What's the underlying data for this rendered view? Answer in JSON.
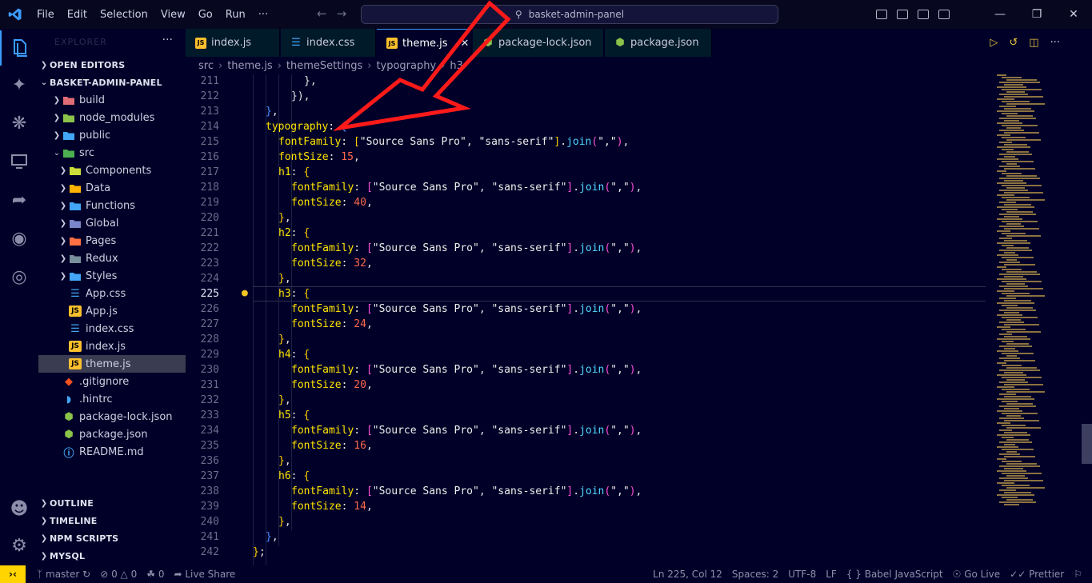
{
  "app": {
    "menu": [
      "File",
      "Edit",
      "Selection",
      "View",
      "Go",
      "Run",
      "···"
    ],
    "search": "basket-admin-panel"
  },
  "sidebar": {
    "title": "EXPLORER",
    "sections": {
      "open_editors": "OPEN EDITORS",
      "project": "BASKET-ADMIN-PANEL",
      "outline": "OUTLINE",
      "timeline": "TIMELINE",
      "npm": "NPM SCRIPTS",
      "mysql": "MYSQL"
    },
    "tree": [
      {
        "label": "build",
        "icon": "folder",
        "color": "#e06c75",
        "indent": 1
      },
      {
        "label": "node_modules",
        "icon": "folder",
        "color": "#8bc34a",
        "indent": 1
      },
      {
        "label": "public",
        "icon": "folder",
        "color": "#42a5f5",
        "indent": 1
      },
      {
        "label": "src",
        "icon": "folder-open",
        "color": "#4caf50",
        "indent": 1
      },
      {
        "label": "Components",
        "icon": "folder",
        "color": "#cddc39",
        "indent": 2
      },
      {
        "label": "Data",
        "icon": "folder",
        "color": "#ffb300",
        "indent": 2
      },
      {
        "label": "Functions",
        "icon": "folder",
        "color": "#42a5f5",
        "indent": 2
      },
      {
        "label": "Global",
        "icon": "folder",
        "color": "#7986cb",
        "indent": 2
      },
      {
        "label": "Pages",
        "icon": "folder",
        "color": "#ff7043",
        "indent": 2
      },
      {
        "label": "Redux",
        "icon": "folder",
        "color": "#78909c",
        "indent": 2
      },
      {
        "label": "Styles",
        "icon": "folder",
        "color": "#42a5f5",
        "indent": 2
      },
      {
        "label": "App.css",
        "icon": "css",
        "color": "#42a5f5",
        "indent": 2
      },
      {
        "label": "App.js",
        "icon": "js",
        "color": "#fbc02d",
        "indent": 2
      },
      {
        "label": "index.css",
        "icon": "css",
        "color": "#42a5f5",
        "indent": 2
      },
      {
        "label": "index.js",
        "icon": "js",
        "color": "#fbc02d",
        "indent": 2
      },
      {
        "label": "theme.js",
        "icon": "js",
        "color": "#fbc02d",
        "indent": 2,
        "selected": true
      },
      {
        "label": ".gitignore",
        "icon": "git",
        "color": "#f4511e",
        "indent": 1
      },
      {
        "label": ".hintrc",
        "icon": "hint",
        "color": "#42a5f5",
        "indent": 1
      },
      {
        "label": "package-lock.json",
        "icon": "node",
        "color": "#8bc34a",
        "indent": 1
      },
      {
        "label": "package.json",
        "icon": "node",
        "color": "#8bc34a",
        "indent": 1
      },
      {
        "label": "README.md",
        "icon": "info",
        "color": "#42a5f5",
        "indent": 1
      }
    ]
  },
  "tabs": [
    {
      "label": "index.js",
      "icon": "js",
      "color": "#fbc02d"
    },
    {
      "label": "index.css",
      "icon": "css",
      "color": "#42a5f5"
    },
    {
      "label": "theme.js",
      "icon": "js",
      "color": "#fbc02d",
      "active": true
    },
    {
      "label": "package-lock.json",
      "icon": "node",
      "color": "#8bc34a"
    },
    {
      "label": "package.json",
      "icon": "node",
      "color": "#8bc34a"
    }
  ],
  "breadcrumb": [
    "src",
    "theme.js",
    "themeSettings",
    "typography",
    "h3"
  ],
  "editor": {
    "current_line": 225,
    "lines": [
      {
        "n": 211,
        "indent": 6,
        "tokens": [
          [
            "p",
            "},"
          ]
        ]
      },
      {
        "n": 212,
        "indent": 5,
        "tokens": [
          [
            "p",
            "}),"
          ]
        ]
      },
      {
        "n": 213,
        "indent": 3,
        "tokens": [
          [
            "b2",
            "}"
          ],
          [
            "p",
            ","
          ]
        ]
      },
      {
        "n": 214,
        "indent": 3,
        "tokens": [
          [
            "k",
            "typography"
          ],
          [
            "p",
            ": "
          ],
          [
            "b2",
            "{"
          ]
        ]
      },
      {
        "n": 215,
        "indent": 4,
        "tokens": [
          [
            "k",
            "fontFamily"
          ],
          [
            "p",
            ": "
          ],
          [
            "b3",
            "["
          ],
          [
            "s",
            "\"Source Sans Pro\""
          ],
          [
            "p",
            ", "
          ],
          [
            "s",
            "\"sans-serif\""
          ],
          [
            "b3",
            "]"
          ],
          [
            "p",
            "."
          ],
          [
            "f",
            "join"
          ],
          [
            "b1",
            "("
          ],
          [
            "s",
            "\",\""
          ],
          [
            "b1",
            ")"
          ],
          [
            "p",
            ","
          ]
        ]
      },
      {
        "n": 216,
        "indent": 4,
        "tokens": [
          [
            "k",
            "fontSize"
          ],
          [
            "p",
            ": "
          ],
          [
            "n",
            "15"
          ],
          [
            "p",
            ","
          ]
        ]
      },
      {
        "n": 217,
        "indent": 4,
        "tokens": [
          [
            "k",
            "h1"
          ],
          [
            "p",
            ": "
          ],
          [
            "b3",
            "{"
          ]
        ]
      },
      {
        "n": 218,
        "indent": 5,
        "tokens": [
          [
            "k",
            "fontFamily"
          ],
          [
            "p",
            ": "
          ],
          [
            "b1",
            "["
          ],
          [
            "s",
            "\"Source Sans Pro\""
          ],
          [
            "p",
            ", "
          ],
          [
            "s",
            "\"sans-serif\""
          ],
          [
            "b1",
            "]"
          ],
          [
            "p",
            "."
          ],
          [
            "f",
            "join"
          ],
          [
            "b1",
            "("
          ],
          [
            "s",
            "\",\""
          ],
          [
            "b1",
            ")"
          ],
          [
            "p",
            ","
          ]
        ]
      },
      {
        "n": 219,
        "indent": 5,
        "tokens": [
          [
            "k",
            "fontSize"
          ],
          [
            "p",
            ": "
          ],
          [
            "n",
            "40"
          ],
          [
            "p",
            ","
          ]
        ]
      },
      {
        "n": 220,
        "indent": 4,
        "tokens": [
          [
            "b3",
            "}"
          ],
          [
            "p",
            ","
          ]
        ]
      },
      {
        "n": 221,
        "indent": 4,
        "tokens": [
          [
            "k",
            "h2"
          ],
          [
            "p",
            ": "
          ],
          [
            "b3",
            "{"
          ]
        ]
      },
      {
        "n": 222,
        "indent": 5,
        "tokens": [
          [
            "k",
            "fontFamily"
          ],
          [
            "p",
            ": "
          ],
          [
            "b1",
            "["
          ],
          [
            "s",
            "\"Source Sans Pro\""
          ],
          [
            "p",
            ", "
          ],
          [
            "s",
            "\"sans-serif\""
          ],
          [
            "b1",
            "]"
          ],
          [
            "p",
            "."
          ],
          [
            "f",
            "join"
          ],
          [
            "b1",
            "("
          ],
          [
            "s",
            "\",\""
          ],
          [
            "b1",
            ")"
          ],
          [
            "p",
            ","
          ]
        ]
      },
      {
        "n": 223,
        "indent": 5,
        "tokens": [
          [
            "k",
            "fontSize"
          ],
          [
            "p",
            ": "
          ],
          [
            "n",
            "32"
          ],
          [
            "p",
            ","
          ]
        ]
      },
      {
        "n": 224,
        "indent": 4,
        "tokens": [
          [
            "b3",
            "}"
          ],
          [
            "p",
            ","
          ]
        ]
      },
      {
        "n": 225,
        "indent": 4,
        "tokens": [
          [
            "k",
            "h3"
          ],
          [
            "p",
            ": "
          ],
          [
            "b3",
            "{"
          ]
        ]
      },
      {
        "n": 226,
        "indent": 5,
        "tokens": [
          [
            "k",
            "fontFamily"
          ],
          [
            "p",
            ": "
          ],
          [
            "b1",
            "["
          ],
          [
            "s",
            "\"Source Sans Pro\""
          ],
          [
            "p",
            ", "
          ],
          [
            "s",
            "\"sans-serif\""
          ],
          [
            "b1",
            "]"
          ],
          [
            "p",
            "."
          ],
          [
            "f",
            "join"
          ],
          [
            "b1",
            "("
          ],
          [
            "s",
            "\",\""
          ],
          [
            "b1",
            ")"
          ],
          [
            "p",
            ","
          ]
        ]
      },
      {
        "n": 227,
        "indent": 5,
        "tokens": [
          [
            "k",
            "fontSize"
          ],
          [
            "p",
            ": "
          ],
          [
            "n",
            "24"
          ],
          [
            "p",
            ","
          ]
        ]
      },
      {
        "n": 228,
        "indent": 4,
        "tokens": [
          [
            "b3",
            "}"
          ],
          [
            "p",
            ","
          ]
        ]
      },
      {
        "n": 229,
        "indent": 4,
        "tokens": [
          [
            "k",
            "h4"
          ],
          [
            "p",
            ": "
          ],
          [
            "b3",
            "{"
          ]
        ]
      },
      {
        "n": 230,
        "indent": 5,
        "tokens": [
          [
            "k",
            "fontFamily"
          ],
          [
            "p",
            ": "
          ],
          [
            "b1",
            "["
          ],
          [
            "s",
            "\"Source Sans Pro\""
          ],
          [
            "p",
            ", "
          ],
          [
            "s",
            "\"sans-serif\""
          ],
          [
            "b1",
            "]"
          ],
          [
            "p",
            "."
          ],
          [
            "f",
            "join"
          ],
          [
            "b1",
            "("
          ],
          [
            "s",
            "\",\""
          ],
          [
            "b1",
            ")"
          ],
          [
            "p",
            ","
          ]
        ]
      },
      {
        "n": 231,
        "indent": 5,
        "tokens": [
          [
            "k",
            "fontSize"
          ],
          [
            "p",
            ": "
          ],
          [
            "n",
            "20"
          ],
          [
            "p",
            ","
          ]
        ]
      },
      {
        "n": 232,
        "indent": 4,
        "tokens": [
          [
            "b3",
            "}"
          ],
          [
            "p",
            ","
          ]
        ]
      },
      {
        "n": 233,
        "indent": 4,
        "tokens": [
          [
            "k",
            "h5"
          ],
          [
            "p",
            ": "
          ],
          [
            "b3",
            "{"
          ]
        ]
      },
      {
        "n": 234,
        "indent": 5,
        "tokens": [
          [
            "k",
            "fontFamily"
          ],
          [
            "p",
            ": "
          ],
          [
            "b1",
            "["
          ],
          [
            "s",
            "\"Source Sans Pro\""
          ],
          [
            "p",
            ", "
          ],
          [
            "s",
            "\"sans-serif\""
          ],
          [
            "b1",
            "]"
          ],
          [
            "p",
            "."
          ],
          [
            "f",
            "join"
          ],
          [
            "b1",
            "("
          ],
          [
            "s",
            "\",\""
          ],
          [
            "b1",
            ")"
          ],
          [
            "p",
            ","
          ]
        ]
      },
      {
        "n": 235,
        "indent": 5,
        "tokens": [
          [
            "k",
            "fontSize"
          ],
          [
            "p",
            ": "
          ],
          [
            "n",
            "16"
          ],
          [
            "p",
            ","
          ]
        ]
      },
      {
        "n": 236,
        "indent": 4,
        "tokens": [
          [
            "b3",
            "}"
          ],
          [
            "p",
            ","
          ]
        ]
      },
      {
        "n": 237,
        "indent": 4,
        "tokens": [
          [
            "k",
            "h6"
          ],
          [
            "p",
            ": "
          ],
          [
            "b3",
            "{"
          ]
        ]
      },
      {
        "n": 238,
        "indent": 5,
        "tokens": [
          [
            "k",
            "fontFamily"
          ],
          [
            "p",
            ": "
          ],
          [
            "b1",
            "["
          ],
          [
            "s",
            "\"Source Sans Pro\""
          ],
          [
            "p",
            ", "
          ],
          [
            "s",
            "\"sans-serif\""
          ],
          [
            "b1",
            "]"
          ],
          [
            "p",
            "."
          ],
          [
            "f",
            "join"
          ],
          [
            "b1",
            "("
          ],
          [
            "s",
            "\",\""
          ],
          [
            "b1",
            ")"
          ],
          [
            "p",
            ","
          ]
        ]
      },
      {
        "n": 239,
        "indent": 5,
        "tokens": [
          [
            "k",
            "fontSize"
          ],
          [
            "p",
            ": "
          ],
          [
            "n",
            "14"
          ],
          [
            "p",
            ","
          ]
        ]
      },
      {
        "n": 240,
        "indent": 4,
        "tokens": [
          [
            "b3",
            "}"
          ],
          [
            "p",
            ","
          ]
        ]
      },
      {
        "n": 241,
        "indent": 3,
        "tokens": [
          [
            "b2",
            "}"
          ],
          [
            "p",
            ","
          ]
        ]
      },
      {
        "n": 242,
        "indent": 2,
        "tokens": [
          [
            "b3",
            "}"
          ],
          [
            "p",
            ";"
          ]
        ]
      }
    ]
  },
  "status": {
    "branch": "master",
    "errors": "0",
    "warnings": "0",
    "ports": "0",
    "live_share": "Live Share",
    "position": "Ln 225, Col 12",
    "spaces": "Spaces: 2",
    "encoding": "UTF-8",
    "eol": "LF",
    "language": "Babel JavaScript",
    "golive": "Go Live",
    "prettier": "Prettier"
  },
  "colors": {
    "accent": "#3b9cff",
    "background": "#000028",
    "annotation_arrow": "#ff1a1a",
    "remote": "#ffd400"
  }
}
